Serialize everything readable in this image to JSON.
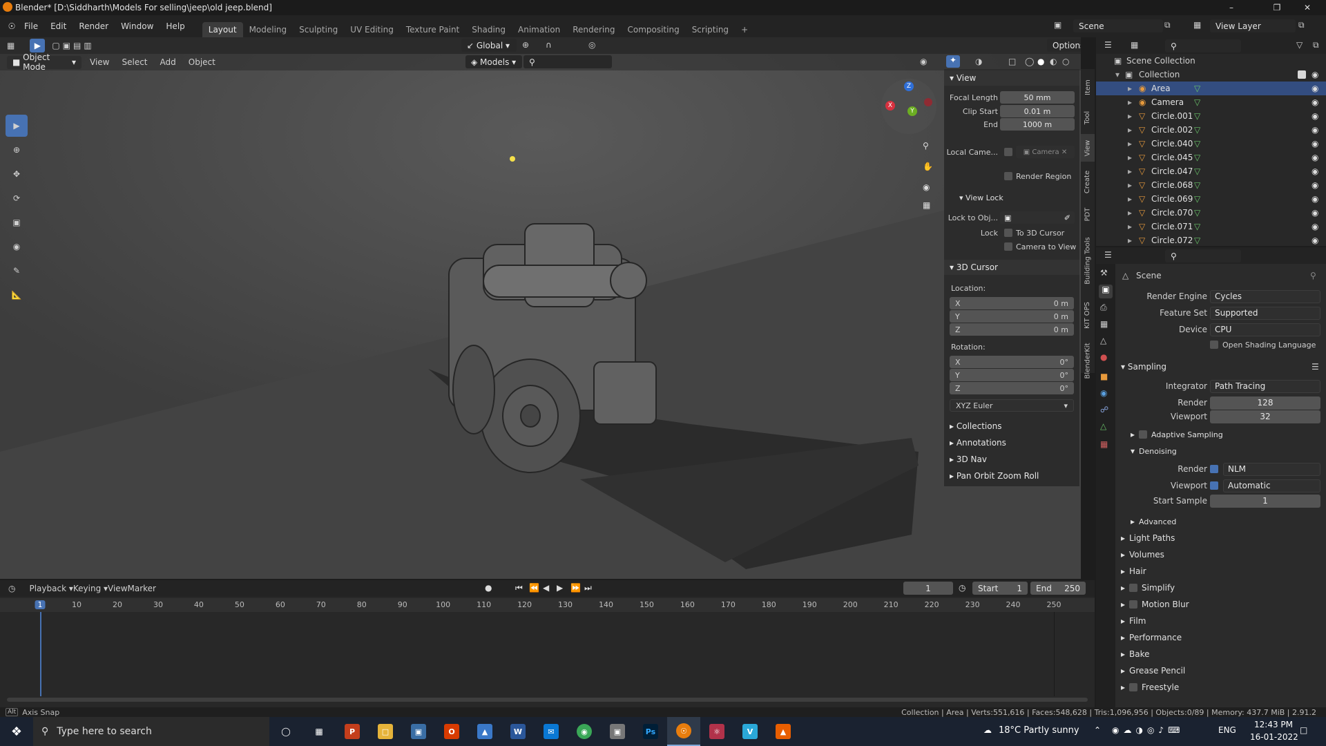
{
  "window": {
    "title": "Blender* [D:\\Siddharth\\Models For selling\\jeep\\old jeep.blend]"
  },
  "menu": {
    "items": [
      "File",
      "Edit",
      "Render",
      "Window",
      "Help"
    ]
  },
  "workspaces": {
    "tabs": [
      "Layout",
      "Modeling",
      "Sculpting",
      "UV Editing",
      "Texture Paint",
      "Shading",
      "Animation",
      "Rendering",
      "Compositing",
      "Scripting"
    ],
    "active": "Layout"
  },
  "scene_field": "Scene",
  "view_layer_field": "View Layer",
  "viewport": {
    "mode": "Object Mode",
    "menus": [
      "View",
      "Select",
      "Add",
      "Object"
    ],
    "transform_orientation": "Global",
    "options_label": "Options",
    "collection_filter": "Models",
    "gizmo": {
      "x": "X",
      "y": "Y",
      "z": "Z"
    }
  },
  "npanel": {
    "view_header": "View",
    "focal_length_label": "Focal Length",
    "focal_length": "50 mm",
    "clip_start_label": "Clip Start",
    "clip_start": "0.01 m",
    "end_label": "End",
    "end": "1000 m",
    "local_camera_label": "Local Came...",
    "local_camera_value": "Camera",
    "render_region": "Render Region",
    "view_lock_header": "View Lock",
    "lock_to_obj_label": "Lock to Obj...",
    "lock_label": "Lock",
    "to_3d_cursor": "To 3D Cursor",
    "camera_to_view": "Camera to View",
    "cursor_header": "3D Cursor",
    "location_label": "Location:",
    "loc": [
      {
        "axis": "X",
        "value": "0 m"
      },
      {
        "axis": "Y",
        "value": "0 m"
      },
      {
        "axis": "Z",
        "value": "0 m"
      }
    ],
    "rotation_label": "Rotation:",
    "rot": [
      {
        "axis": "X",
        "value": "0°"
      },
      {
        "axis": "Y",
        "value": "0°"
      },
      {
        "axis": "Z",
        "value": "0°"
      }
    ],
    "rotation_mode": "XYZ Euler",
    "collapsed": [
      "Collections",
      "Annotations",
      "3D Nav",
      "Pan Orbit Zoom Roll"
    ]
  },
  "side_tabs": [
    "Item",
    "Tool",
    "View",
    "Create",
    "PDT",
    "Building Tools",
    "KIT OPS",
    "BlenderKit"
  ],
  "outliner": {
    "root": "Scene Collection",
    "collection": "Collection",
    "items": [
      "Area",
      "Camera",
      "Circle.001",
      "Circle.002",
      "Circle.040",
      "Circle.045",
      "Circle.047",
      "Circle.068",
      "Circle.069",
      "Circle.070",
      "Circle.071",
      "Circle.072"
    ]
  },
  "properties": {
    "context": "Scene",
    "render_engine_label": "Render Engine",
    "render_engine": "Cycles",
    "feature_set_label": "Feature Set",
    "feature_set": "Supported",
    "device_label": "Device",
    "device": "CPU",
    "osl": "Open Shading Language",
    "sampling": "Sampling",
    "integrator_label": "Integrator",
    "integrator": "Path Tracing",
    "render_label": "Render",
    "render_samples": "128",
    "viewport_label": "Viewport",
    "viewport_samples": "32",
    "adaptive_sampling": "Adaptive Sampling",
    "denoising": "Denoising",
    "denoise_render": "NLM",
    "denoise_viewport": "Automatic",
    "start_sample_label": "Start Sample",
    "start_sample": "1",
    "advanced": "Advanced",
    "panels": [
      "Light Paths",
      "Volumes",
      "Hair",
      "Simplify",
      "Motion Blur",
      "Film",
      "Performance",
      "Bake",
      "Grease Pencil",
      "Freestyle"
    ]
  },
  "timeline": {
    "menus": [
      "Playback",
      "Keying",
      "View",
      "Marker"
    ],
    "current_frame": "1",
    "start_label": "Start",
    "start": "1",
    "end_label": "End",
    "end": "250",
    "ruler": [
      "1",
      "10",
      "20",
      "30",
      "40",
      "50",
      "60",
      "70",
      "80",
      "90",
      "100",
      "110",
      "120",
      "130",
      "140",
      "150",
      "160",
      "170",
      "180",
      "190",
      "200",
      "210",
      "220",
      "230",
      "240",
      "250"
    ]
  },
  "status": {
    "key": "Alt",
    "hint": "Axis Snap",
    "info": "Collection | Area | Verts:551,616 | Faces:548,628 | Tris:1,096,956 | Objects:0/89 | Memory: 437.7 MiB | 2.91.2"
  },
  "taskbar": {
    "search_placeholder": "Type here to search",
    "weather": "18°C  Partly sunny",
    "lang": "ENG",
    "time": "12:43 PM",
    "date": "16-01-2022",
    "apps": [
      "cortana-icon",
      "task-view-icon",
      "powerpoint-icon",
      "file-explorer-icon",
      "store-icon",
      "office-icon",
      "app-icon",
      "word-icon",
      "mail-icon",
      "chrome-icon",
      "app2-icon",
      "photoshop-icon",
      "blender-icon",
      "app3-icon",
      "app4-icon",
      "vlc-icon"
    ]
  },
  "colors": {
    "accent": "#4772b3",
    "viewport_bg": "#3d3d3d",
    "panel_bg": "#2c2c2c"
  }
}
